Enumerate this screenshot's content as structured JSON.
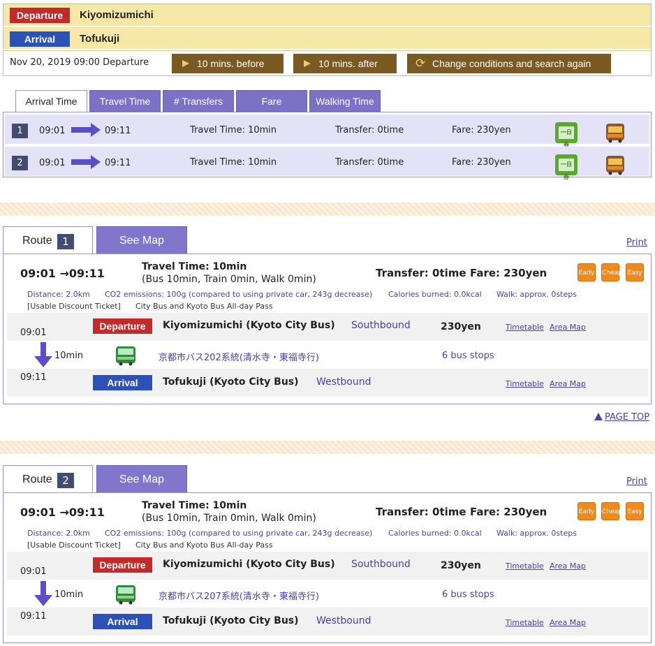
{
  "search": {
    "departure_label": "Departure",
    "departure_station": "Kiyomizumichi",
    "arrival_label": "Arrival",
    "arrival_station": "Tofukuji",
    "condition": "Nov 20, 2019 09:00 Departure",
    "btn_before": "10 mins. before",
    "btn_after": "10 mins. after",
    "btn_change": "Change conditions and search again"
  },
  "sort_tabs": [
    "Arrival Time",
    "Travel Time",
    "# Transfers",
    "Fare",
    "Walking Time"
  ],
  "results": [
    {
      "num": "1",
      "dep": "09:01",
      "arr": "09:11",
      "travel": "Travel Time: 10min",
      "transfer": "Transfer: 0time",
      "fare": "Fare: 230yen"
    },
    {
      "num": "2",
      "dep": "09:01",
      "arr": "09:11",
      "travel": "Travel Time: 10min",
      "transfer": "Transfer: 0time",
      "fare": "Fare: 230yen"
    }
  ],
  "ticket_icon_text": "一日券",
  "routes": [
    {
      "tab_label": "Route",
      "num": "1",
      "map_tab": "See Map",
      "print": "Print",
      "times": "09:01 →09:11",
      "travel_time": "Travel Time: 10min",
      "breakdown": "(Bus 10min, Train 0min, Walk 0min)",
      "transfer": "Transfer: 0time",
      "fare": "Fare: 230yen",
      "badges": [
        "Early",
        "Cheap",
        "Easy"
      ],
      "distance": "Distance: 2.0km",
      "co2": "CO2 emissions: 100g (compared to using private car, 243g decrease)",
      "calories": "Calories burned: 0.0kcal",
      "walk": "Walk: approx. 0steps",
      "ticket_label": "[Usable Discount Ticket]",
      "ticket_name": "City Bus and Kyoto Bus All-day Pass",
      "dep_time": "09:01",
      "dep_chip": "Departure",
      "dep_station": "Kiyomizumichi (Kyoto City Bus)",
      "dep_dir": "Southbound",
      "dep_fare": "230yen",
      "timetable": "Timetable",
      "area_map": "Area Map",
      "ride_min": "10min",
      "line_name": "京都市バス202系統(清水寺・東福寺行)",
      "stops": "6 bus stops",
      "arr_time": "09:11",
      "arr_chip": "Arrival",
      "arr_station": "Tofukuji (Kyoto City Bus)",
      "arr_dir": "Westbound"
    },
    {
      "tab_label": "Route",
      "num": "2",
      "map_tab": "See Map",
      "print": "Print",
      "times": "09:01 →09:11",
      "travel_time": "Travel Time: 10min",
      "breakdown": "(Bus 10min, Train 0min, Walk 0min)",
      "transfer": "Transfer: 0time",
      "fare": "Fare: 230yen",
      "badges": [
        "Early",
        "Cheap",
        "Easy"
      ],
      "distance": "Distance: 2.0km",
      "co2": "CO2 emissions: 100g (compared to using private car, 243g decrease)",
      "calories": "Calories burned: 0.0kcal",
      "walk": "Walk: approx. 0steps",
      "ticket_label": "[Usable Discount Ticket]",
      "ticket_name": "City Bus and Kyoto Bus All-day Pass",
      "dep_time": "09:01",
      "dep_chip": "Departure",
      "dep_station": "Kiyomizumichi (Kyoto City Bus)",
      "dep_dir": "Southbound",
      "dep_fare": "230yen",
      "timetable": "Timetable",
      "area_map": "Area Map",
      "ride_min": "10min",
      "line_name": "京都市バス207系統(清水寺・東福寺行)",
      "stops": "6 bus stops",
      "arr_time": "09:11",
      "arr_chip": "Arrival",
      "arr_station": "Tofukuji (Kyoto City Bus)",
      "arr_dir": "Westbound"
    }
  ],
  "page_top": "PAGE TOP",
  "colors": {
    "accent_purple": "#7c71c4",
    "departure_red": "#c32a2a",
    "arrival_blue": "#2d52b7",
    "header_yellow": "#f6e8a6",
    "button_brown": "#7a5a22"
  }
}
